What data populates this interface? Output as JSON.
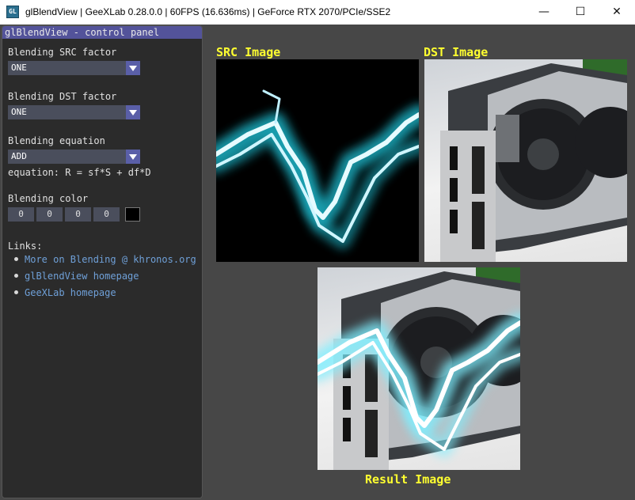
{
  "window": {
    "title": "glBlendView | GeeXLab 0.28.0.0 | 60FPS (16.636ms) | GeForce RTX 2070/PCIe/SSE2",
    "icon_text": "GL",
    "minimize_glyph": "—",
    "maximize_glyph": "☐",
    "close_glyph": "✕"
  },
  "panel": {
    "title": "glBlendView - control panel",
    "src_factor_label": "Blending SRC factor",
    "src_factor_value": "ONE",
    "dst_factor_label": "Blending DST factor",
    "dst_factor_value": "ONE",
    "equation_label": "Blending equation",
    "equation_value": "ADD",
    "equation_text": "equation: R = sf*S + df*D",
    "color_label": "Blending color",
    "color_values": [
      "0",
      "0",
      "0",
      "0"
    ],
    "color_swatch": "#000000",
    "links_label": "Links:",
    "links": [
      "More on Blending @ khronos.org",
      "glBlendView homepage",
      "GeeXLab homepage"
    ]
  },
  "viewport": {
    "src_label": "SRC Image",
    "dst_label": "DST Image",
    "result_label": "Result Image"
  },
  "colors": {
    "panel_title_bg": "#53539a",
    "label_yellow": "#ffff30",
    "link_blue": "#6fa0d8"
  }
}
